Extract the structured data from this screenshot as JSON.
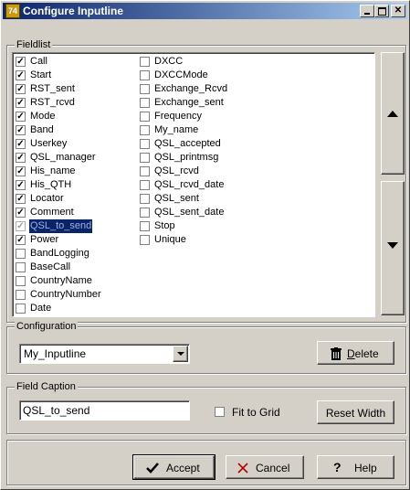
{
  "window": {
    "title": "Configure Inputline",
    "icon_text": "74"
  },
  "fieldlist": {
    "label": "Fieldlist",
    "col1": [
      {
        "label": "Call",
        "checked": true
      },
      {
        "label": "Start",
        "checked": true
      },
      {
        "label": "RST_sent",
        "checked": true
      },
      {
        "label": "RST_rcvd",
        "checked": true
      },
      {
        "label": "Mode",
        "checked": true
      },
      {
        "label": "Band",
        "checked": true
      },
      {
        "label": "Userkey",
        "checked": true
      },
      {
        "label": "QSL_manager",
        "checked": true
      },
      {
        "label": "His_name",
        "checked": true
      },
      {
        "label": "His_QTH",
        "checked": true
      },
      {
        "label": "Locator",
        "checked": true
      },
      {
        "label": "Comment",
        "checked": true
      },
      {
        "label": "QSL_to_send",
        "checked": true,
        "disabled": true,
        "selected": true
      },
      {
        "label": "Power",
        "checked": true
      },
      {
        "label": "BandLogging",
        "checked": false
      },
      {
        "label": "BaseCall",
        "checked": false
      },
      {
        "label": "CountryName",
        "checked": false
      },
      {
        "label": "CountryNumber",
        "checked": false
      },
      {
        "label": "Date",
        "checked": false
      }
    ],
    "col2": [
      {
        "label": "DXCC",
        "checked": false
      },
      {
        "label": "DXCCMode",
        "checked": false
      },
      {
        "label": "Exchange_Rcvd",
        "checked": false
      },
      {
        "label": "Exchange_sent",
        "checked": false
      },
      {
        "label": "Frequency",
        "checked": false
      },
      {
        "label": "My_name",
        "checked": false
      },
      {
        "label": "QSL_accepted",
        "checked": false
      },
      {
        "label": "QSL_printmsg",
        "checked": false
      },
      {
        "label": "QSL_rcvd",
        "checked": false
      },
      {
        "label": "QSL_rcvd_date",
        "checked": false
      },
      {
        "label": "QSL_sent",
        "checked": false
      },
      {
        "label": "QSL_sent_date",
        "checked": false
      },
      {
        "label": "Stop",
        "checked": false
      },
      {
        "label": "Unique",
        "checked": false
      }
    ]
  },
  "configuration": {
    "label": "Configuration",
    "selected": "My_Inputline",
    "delete_label_u": "D",
    "delete_label_rest": "elete"
  },
  "caption": {
    "label": "Field Caption",
    "value": "QSL_to_send",
    "fit_label": "Fit to Grid",
    "fit_checked": false,
    "reset_label": "Reset Width"
  },
  "actions": {
    "accept": "Accept",
    "cancel": "Cancel",
    "help": "Help"
  },
  "icons": {
    "up": "arrow-up",
    "down": "arrow-down",
    "delete": "trash",
    "accept": "checkmark",
    "cancel": "x",
    "help": "question"
  }
}
